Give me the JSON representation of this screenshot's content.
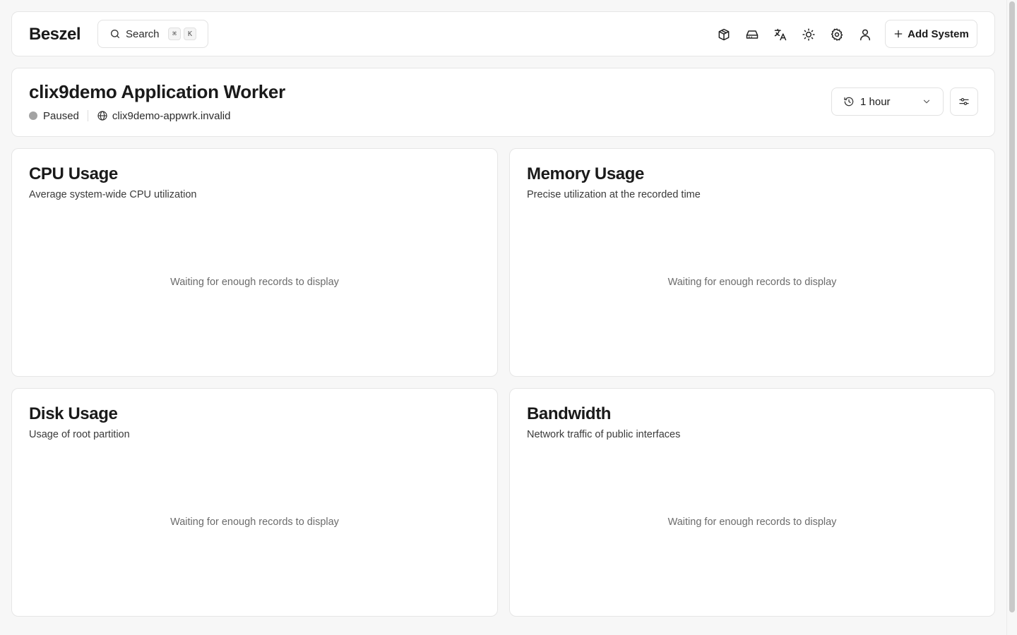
{
  "app": {
    "logo": "Beszel"
  },
  "search": {
    "label": "Search",
    "shortcut_mod": "⌘",
    "shortcut_key": "K"
  },
  "nav": {
    "icons": [
      "containers-icon",
      "disk-icon",
      "language-icon",
      "theme-icon",
      "settings-icon",
      "user-icon"
    ],
    "add_system_label": "Add System"
  },
  "system": {
    "name": "clix9demo Application Worker",
    "status": "Paused",
    "status_color": "#a3a3a3",
    "host": "clix9demo-appwrk.invalid",
    "time_range": "1 hour"
  },
  "charts": [
    {
      "title": "CPU Usage",
      "description": "Average system-wide CPU utilization",
      "empty_text": "Waiting for enough records to display"
    },
    {
      "title": "Memory Usage",
      "description": "Precise utilization at the recorded time",
      "empty_text": "Waiting for enough records to display"
    },
    {
      "title": "Disk Usage",
      "description": "Usage of root partition",
      "empty_text": "Waiting for enough records to display"
    },
    {
      "title": "Bandwidth",
      "description": "Network traffic of public interfaces",
      "empty_text": "Waiting for enough records to display"
    }
  ]
}
